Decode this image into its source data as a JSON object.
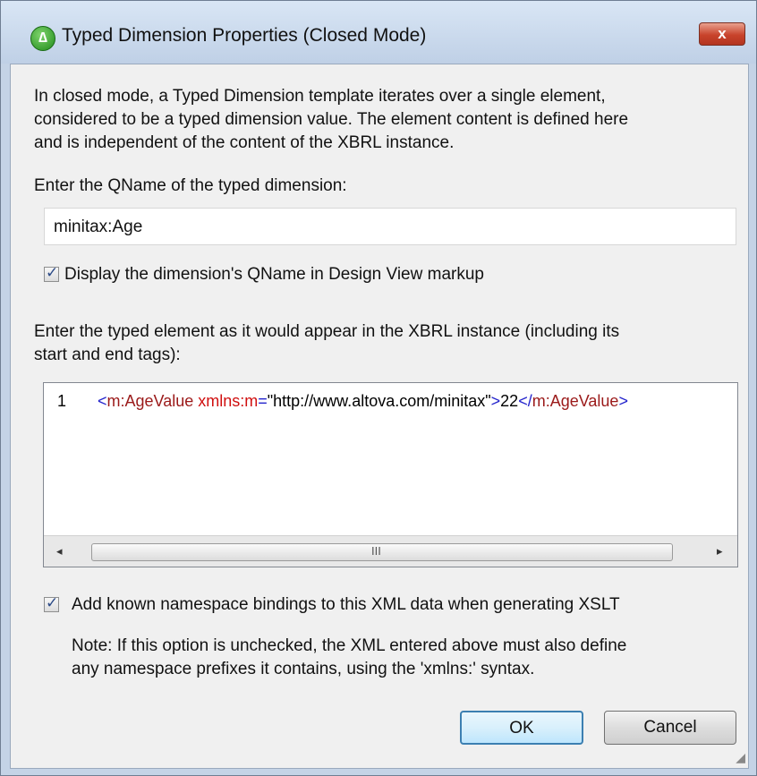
{
  "window": {
    "title": "Typed Dimension Properties (Closed Mode)",
    "close_glyph": "x"
  },
  "intro": {
    "line1": "In closed mode, a Typed Dimension template iterates over a single element,",
    "line2": "considered to be a typed dimension value. The element content is defined here",
    "line3": "and is independent of the content of the XBRL instance."
  },
  "qname": {
    "label": "Enter the QName of the typed dimension:",
    "value": "minitax:Age"
  },
  "display_option": {
    "label": "Display the dimension's QName in Design View markup",
    "checked": true
  },
  "element_prompt": {
    "line1": "Enter the typed element as it would appear in the XBRL instance (including its",
    "line2": "start and end tags):"
  },
  "editor": {
    "line_number": "1",
    "tokens": {
      "open_lt": "<",
      "tag_open": "m:AgeValue",
      "attr": " xmlns:m",
      "eq": "=",
      "quote1": "\"",
      "attr_value": "http://www.altova.com/minitax",
      "quote2": "\"",
      "gt": ">",
      "text": "22",
      "close_lt": "</",
      "tag_close": "m:AgeValue",
      "close_gt": ">"
    },
    "scroll_left_glyph": "◂",
    "scroll_right_glyph": "▸",
    "thumb_grip": "III"
  },
  "namespace_option": {
    "label": "Add known namespace bindings to this XML data when generating XSLT",
    "checked": true
  },
  "note": {
    "line1": "Note: If this option is unchecked, the XML entered above must also define",
    "line2": "any namespace prefixes it contains, using the 'xmlns:' syntax."
  },
  "buttons": {
    "ok": "OK",
    "cancel": "Cancel"
  },
  "icons": {
    "app": "altova-app-icon",
    "close": "close-icon",
    "check": "checkmark-icon",
    "resize": "resize-grip-icon"
  }
}
